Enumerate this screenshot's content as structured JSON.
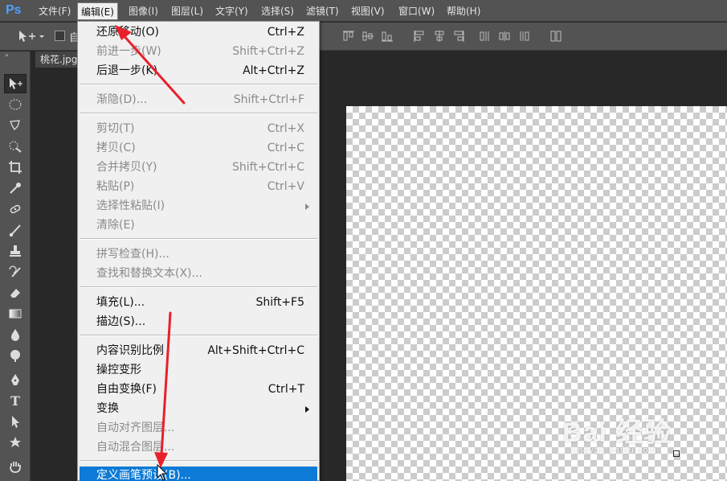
{
  "app": {
    "logo": "Ps",
    "accent": "#4ea1ff"
  },
  "menubar": {
    "items": [
      {
        "label": "文件(F)"
      },
      {
        "label": "编辑(E)",
        "active": true
      },
      {
        "label": "图像(I)"
      },
      {
        "label": "图层(L)"
      },
      {
        "label": "文字(Y)"
      },
      {
        "label": "选择(S)"
      },
      {
        "label": "滤镜(T)"
      },
      {
        "label": "视图(V)"
      },
      {
        "label": "窗口(W)"
      },
      {
        "label": "帮助(H)"
      }
    ]
  },
  "options_bar": {
    "tool_icon": "move-tool-icon",
    "auto_select_label": "自",
    "align_icons": [
      "align-top-icon",
      "align-vcenter-icon",
      "align-bottom-icon",
      "align-left-icon",
      "align-hcenter-icon",
      "align-right-icon",
      "distribute-top-icon",
      "distribute-vcenter-icon",
      "distribute-bottom-icon",
      "distribute-left-icon",
      "distribute-hcenter-icon",
      "distribute-right-icon",
      "auto-align-icon"
    ]
  },
  "document": {
    "tab_label": "桃花.jpg"
  },
  "watermark": {
    "brand": "Bai 经验",
    "sub": "jingyan.baidu.com"
  },
  "edit_menu": {
    "highlight_color": "#0c7ad6",
    "items": [
      {
        "label": "还原移动(O)",
        "shortcut": "Ctrl+Z",
        "disabled": false
      },
      {
        "label": "前进一步(W)",
        "shortcut": "Shift+Ctrl+Z",
        "disabled": true
      },
      {
        "label": "后退一步(K)",
        "shortcut": "Alt+Ctrl+Z",
        "disabled": false
      },
      {
        "label": "渐隐(D)...",
        "shortcut": "Shift+Ctrl+F",
        "disabled": true
      },
      {
        "label": "剪切(T)",
        "shortcut": "Ctrl+X",
        "disabled": true
      },
      {
        "label": "拷贝(C)",
        "shortcut": "Ctrl+C",
        "disabled": true
      },
      {
        "label": "合并拷贝(Y)",
        "shortcut": "Shift+Ctrl+C",
        "disabled": true
      },
      {
        "label": "粘贴(P)",
        "shortcut": "Ctrl+V",
        "disabled": true
      },
      {
        "label": "选择性粘贴(I)",
        "shortcut": "",
        "disabled": true,
        "submenu": true
      },
      {
        "label": "清除(E)",
        "shortcut": "",
        "disabled": true
      },
      {
        "label": "拼写检查(H)...",
        "shortcut": "",
        "disabled": true
      },
      {
        "label": "查找和替换文本(X)...",
        "shortcut": "",
        "disabled": true
      },
      {
        "label": "填充(L)...",
        "shortcut": "Shift+F5",
        "disabled": false
      },
      {
        "label": "描边(S)...",
        "shortcut": "",
        "disabled": false
      },
      {
        "label": "内容识别比例",
        "shortcut": "Alt+Shift+Ctrl+C",
        "disabled": false
      },
      {
        "label": "操控变形",
        "shortcut": "",
        "disabled": false
      },
      {
        "label": "自由变换(F)",
        "shortcut": "Ctrl+T",
        "disabled": false
      },
      {
        "label": "变换",
        "shortcut": "",
        "disabled": false,
        "submenu": true
      },
      {
        "label": "自动对齐图层...",
        "shortcut": "",
        "disabled": true
      },
      {
        "label": "自动混合图层...",
        "shortcut": "",
        "disabled": true
      },
      {
        "label": "定义画笔预设(B)...",
        "shortcut": "",
        "disabled": false,
        "highlighted": true
      }
    ]
  },
  "tools": [
    "move-tool-icon",
    "marquee-tool-icon",
    "lasso-tool-icon",
    "quick-select-tool-icon",
    "crop-tool-icon",
    "eyedropper-tool-icon",
    "healing-brush-tool-icon",
    "brush-tool-icon",
    "clone-stamp-tool-icon",
    "history-brush-tool-icon",
    "eraser-tool-icon",
    "gradient-tool-icon",
    "blur-tool-icon",
    "dodge-tool-icon",
    "pen-tool-icon",
    "type-tool-icon",
    "path-select-tool-icon",
    "shape-tool-icon",
    "hand-tool-icon"
  ]
}
